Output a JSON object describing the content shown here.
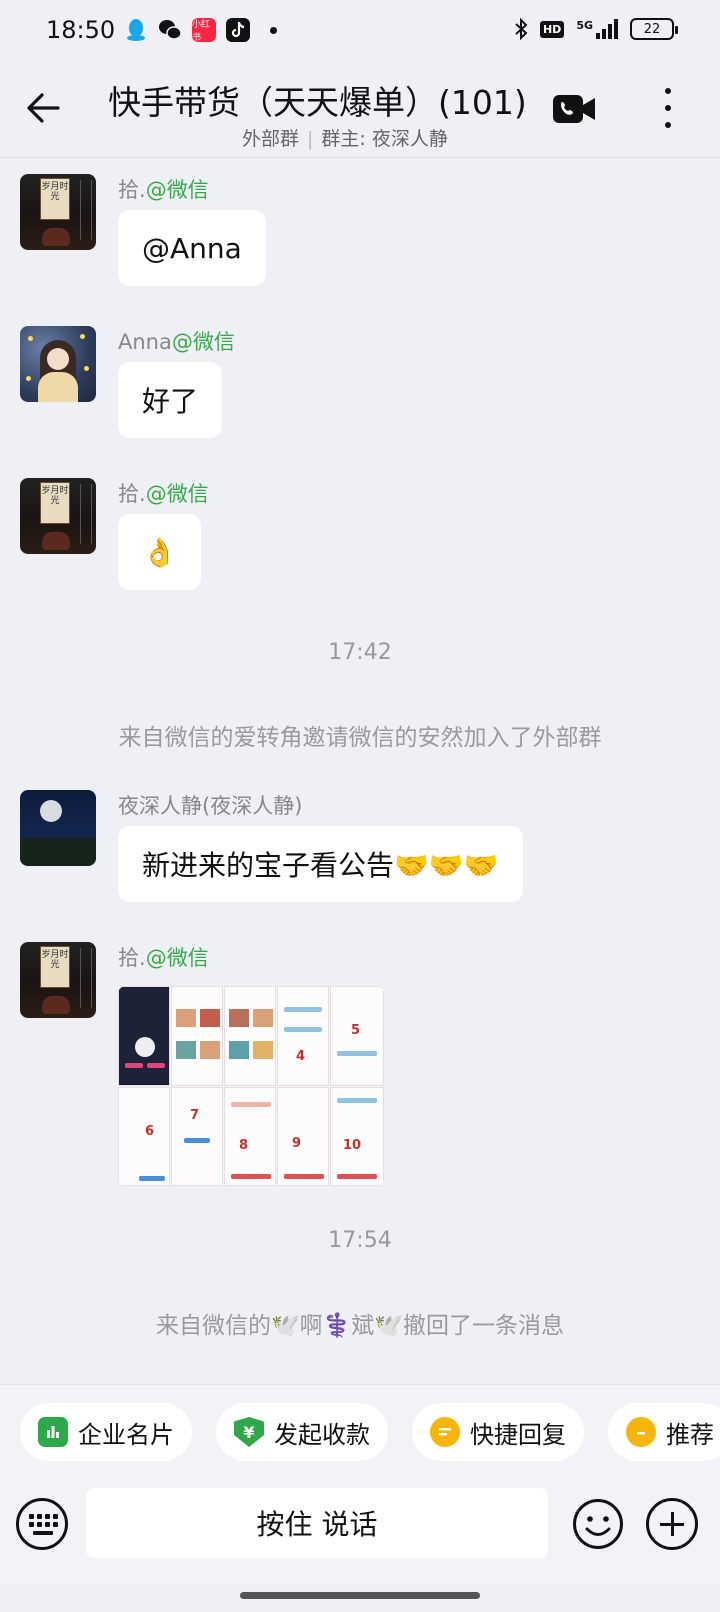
{
  "status_bar": {
    "time": "18:50",
    "network": "5G",
    "hd_label": "HD",
    "battery": "22",
    "app_icons": [
      "qq-icon",
      "wechat-icon",
      "xiaohongshu-icon",
      "douyin-icon"
    ]
  },
  "header": {
    "title": "快手带货（天天爆单）(101)",
    "group_type": "外部群",
    "owner": "群主: 夜深人静"
  },
  "messages": [
    {
      "sender": "拾.",
      "tag": "@微信",
      "text": "@Anna"
    },
    {
      "sender": "Anna",
      "tag": "@微信",
      "text": "好了"
    },
    {
      "sender": "拾.",
      "tag": "@微信",
      "text": "👌"
    },
    {
      "sender": "夜深人静(夜深人静)",
      "tag": "",
      "text": "新进来的宝子看公告🤝🤝🤝"
    },
    {
      "sender": "拾.",
      "tag": "@微信",
      "text": ""
    }
  ],
  "avatar_scroll_text": "岁月时光",
  "timestamps": [
    "17:42",
    "17:54"
  ],
  "system_notices": [
    "来自微信的爱转角邀请微信的安然加入了外部群",
    "来自微信的🕊️啊⚕️斌🕊️撤回了一条消息"
  ],
  "image_message": {
    "step_numbers": [
      "4",
      "5",
      "6",
      "7",
      "8",
      "9",
      "10"
    ]
  },
  "quick_actions": [
    {
      "label": "企业名片",
      "icon": "business-card-icon",
      "color": "#2ea84a"
    },
    {
      "label": "发起收款",
      "icon": "payment-icon",
      "color": "#2ea84a"
    },
    {
      "label": "快捷回复",
      "icon": "quick-reply-icon",
      "color": "#f5b50b"
    },
    {
      "label": "推荐",
      "icon": "recommend-icon",
      "color": "#f5b50b"
    }
  ],
  "input_bar": {
    "talk_label": "按住 说话"
  },
  "colors": {
    "accent_green": "#3aa84a",
    "background": "#eef0f6"
  }
}
